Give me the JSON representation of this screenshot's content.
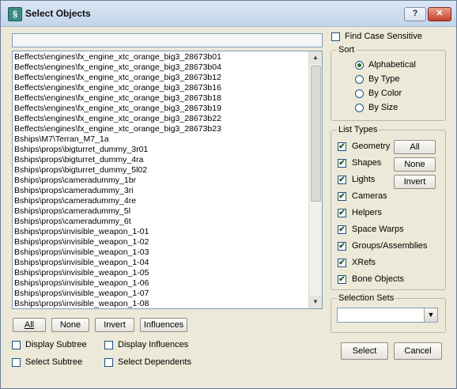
{
  "window": {
    "title": "Select Objects",
    "help_label": "?",
    "close_label": "✕"
  },
  "search": {
    "value": ""
  },
  "objects": [
    "Beffects\\engines\\fx_engine_xtc_orange_big3_28673b01",
    "Beffects\\engines\\fx_engine_xtc_orange_big3_28673b04",
    "Beffects\\engines\\fx_engine_xtc_orange_big3_28673b12",
    "Beffects\\engines\\fx_engine_xtc_orange_big3_28673b16",
    "Beffects\\engines\\fx_engine_xtc_orange_big3_28673b18",
    "Beffects\\engines\\fx_engine_xtc_orange_big3_28673b19",
    "Beffects\\engines\\fx_engine_xtc_orange_big3_28673b22",
    "Beffects\\engines\\fx_engine_xtc_orange_big3_28673b23",
    "Bships\\M7\\Terran_M7_1a",
    "Bships\\props\\bigturret_dummy_3r01",
    "Bships\\props\\bigturret_dummy_4ra",
    "Bships\\props\\bigturret_dummy_5l02",
    "Bships\\props\\cameradummy_1br",
    "Bships\\props\\cameradummy_3ri",
    "Bships\\props\\cameradummy_4re",
    "Bships\\props\\cameradummy_5l",
    "Bships\\props\\cameradummy_6t",
    "Bships\\props\\invisible_weapon_1-01",
    "Bships\\props\\invisible_weapon_1-02",
    "Bships\\props\\invisible_weapon_1-03",
    "Bships\\props\\invisible_weapon_1-04",
    "Bships\\props\\invisible_weapon_1-05",
    "Bships\\props\\invisible_weapon_1-06",
    "Bships\\props\\invisible_weapon_1-07",
    "Bships\\props\\invisible_weapon_1-08"
  ],
  "list_buttons": {
    "all": "All",
    "none": "None",
    "invert": "Invert",
    "influences": "Influences"
  },
  "options": {
    "display_subtree": {
      "label": "Display Subtree",
      "checked": false
    },
    "display_influences": {
      "label": "Display Influences",
      "checked": false
    },
    "select_subtree": {
      "label": "Select Subtree",
      "checked": false
    },
    "select_dependents": {
      "label": "Select Dependents",
      "checked": false
    }
  },
  "find_case_sensitive": {
    "label": "Find Case Sensitive",
    "checked": false
  },
  "sort": {
    "legend": "Sort",
    "options": [
      "Alphabetical",
      "By Type",
      "By Color",
      "By Size"
    ],
    "selected": "Alphabetical"
  },
  "list_types": {
    "legend": "List Types",
    "items": [
      "Geometry",
      "Shapes",
      "Lights",
      "Cameras",
      "Helpers",
      "Space Warps",
      "Groups/Assemblies",
      "XRefs",
      "Bone Objects"
    ],
    "all_label": "All",
    "none_label": "None",
    "invert_label": "Invert"
  },
  "selection_sets": {
    "legend": "Selection Sets",
    "value": ""
  },
  "actions": {
    "select": "Select",
    "cancel": "Cancel"
  },
  "check_mark": "✔",
  "icons": {
    "app": "3ds-max-icon",
    "scroll_up": "▲",
    "scroll_down": "▼",
    "dropdown": "▼"
  }
}
